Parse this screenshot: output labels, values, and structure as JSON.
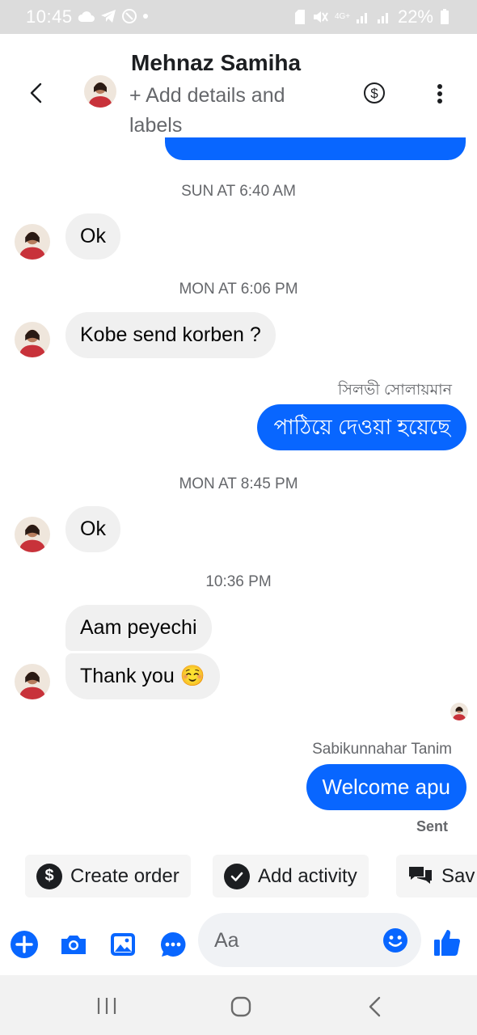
{
  "status_bar": {
    "time": "10:45",
    "battery": "22%",
    "network": "4G+",
    "left_icons": [
      "cloud-icon",
      "telegram-icon",
      "clock-icon",
      "dot-icon"
    ],
    "right_icons": [
      "sim-icon",
      "mute-icon",
      "network-icon",
      "signal-icon",
      "signal-icon",
      "battery-icon"
    ]
  },
  "header": {
    "name": "Mehnaz Samiha",
    "subtitle": "+ Add details and labels"
  },
  "messages": [
    {
      "type": "timestamp",
      "text": "SUN AT 6:40 AM"
    },
    {
      "type": "incoming",
      "text": "Ok"
    },
    {
      "type": "timestamp",
      "text": "MON AT 6:06 PM"
    },
    {
      "type": "incoming",
      "text": "Kobe send korben ?"
    },
    {
      "type": "sender",
      "text": "সিলভী সোলায়মান"
    },
    {
      "type": "outgoing",
      "text": "পাঠিয়ে দেওয়া হয়েছে"
    },
    {
      "type": "timestamp",
      "text": "MON AT 8:45 PM"
    },
    {
      "type": "incoming",
      "text": "Ok"
    },
    {
      "type": "timestamp",
      "text": "10:36 PM"
    },
    {
      "type": "incoming",
      "text": "Aam peyechi"
    },
    {
      "type": "incoming",
      "text": "Thank you ☺️"
    },
    {
      "type": "sender",
      "text": "Sabikunnahar Tanim"
    },
    {
      "type": "outgoing",
      "text": "Welcome apu"
    },
    {
      "type": "status",
      "text": "Sent"
    }
  ],
  "quick_actions": [
    {
      "label": "Create order",
      "icon": "dollar-circle-icon"
    },
    {
      "label": "Add activity",
      "icon": "check-circle-icon"
    },
    {
      "label": "Sav",
      "icon": "chat-bubbles-icon"
    }
  ],
  "composer": {
    "placeholder": "Aa",
    "icons": [
      "plus-icon",
      "camera-icon",
      "gallery-icon",
      "more-options-icon",
      "emoji-icon",
      "thumbs-up-icon"
    ]
  },
  "colors": {
    "accent": "#0866ff",
    "incoming_bubble": "#f0f0f0",
    "secondary_text": "#65676b",
    "status_bar": "#dcdcdc"
  }
}
